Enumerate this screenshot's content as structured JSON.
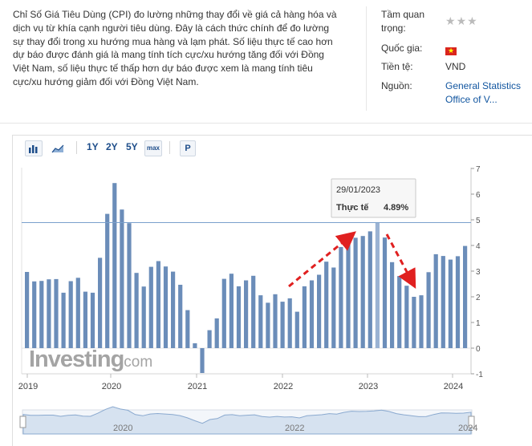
{
  "description": "Chỉ Số Giá Tiêu Dùng (CPI) đo lường những thay đổi về giá cả hàng hóa và dịch vụ từ khía cạnh người tiêu dùng. Đây là cách thức chính để đo lường sự thay đổi trong xu hướng mua hàng và lạm phát. Số liệu thực tế cao hơn dự báo được đánh giá là mang tính tích cực/xu hướng tăng đối với Đồng Việt Nam, số liệu thực tế thấp hơn dự báo được xem là mang tính tiêu cực/xu hướng giảm đối với Đồng Việt Nam.",
  "meta": {
    "importance_label": "Tầm quan trọng:",
    "importance_stars": 3,
    "country_label": "Quốc gia:",
    "country_icon": "vietnam-flag-icon",
    "currency_label": "Tiền tệ:",
    "currency_value": "VND",
    "source_label": "Nguồn:",
    "source_value": "General Statistics Office of V..."
  },
  "toolbar": {
    "bar_chart_icon": "bar-chart-icon",
    "area_chart_icon": "area-chart-icon",
    "range_1y": "1Y",
    "range_2y": "2Y",
    "range_5y": "5Y",
    "range_max": "max",
    "percent_button": "P"
  },
  "watermark": {
    "brand": "Investing",
    "suffix": ".com"
  },
  "tooltip": {
    "date": "29/01/2023",
    "label": "Thực tế",
    "value": "4.89%"
  },
  "navigator": {
    "labels": [
      "2020",
      "2022",
      "2024"
    ]
  },
  "colors": {
    "bar": "#6b8db9",
    "highlight_bar": "#9bb3d3",
    "reference_line": "#7aa0cc",
    "arrow": "#e02020",
    "link": "#1256a0"
  },
  "chart_data": {
    "type": "bar",
    "title": "",
    "xlabel": "",
    "ylabel": "",
    "ylim": [
      -1,
      7
    ],
    "yticks": [
      "-1",
      "0",
      "1",
      "2",
      "3",
      "4",
      "5",
      "6",
      "7"
    ],
    "xticks": [
      "2019",
      "2020",
      "2021",
      "2022",
      "2023",
      "2024"
    ],
    "reference_line": 4.89,
    "highlighted_date": "29/01/2023",
    "series": [
      {
        "values": [
          2.97,
          2.6,
          2.62,
          2.68,
          2.69,
          2.16,
          2.61,
          2.74,
          2.2,
          2.16,
          3.52,
          5.23,
          6.43,
          5.4,
          4.87,
          2.93,
          2.4,
          3.17,
          3.39,
          3.18,
          2.98,
          2.47,
          1.48,
          0.19,
          -0.97,
          0.7,
          1.16,
          2.7,
          2.9,
          2.41,
          2.64,
          2.82,
          2.06,
          1.77,
          2.1,
          1.81,
          1.94,
          1.42,
          2.41,
          2.64,
          2.86,
          3.37,
          3.14,
          3.94,
          4.44,
          4.3,
          4.37,
          4.55,
          4.89,
          4.31,
          3.35,
          2.81,
          2.43,
          2.0,
          2.06,
          2.96,
          3.66,
          3.59,
          3.45,
          3.58,
          3.98
        ]
      }
    ],
    "annotations": [
      {
        "type": "arrow",
        "direction": "up",
        "style": "dashed"
      },
      {
        "type": "arrow",
        "direction": "down",
        "style": "dashed"
      }
    ]
  }
}
